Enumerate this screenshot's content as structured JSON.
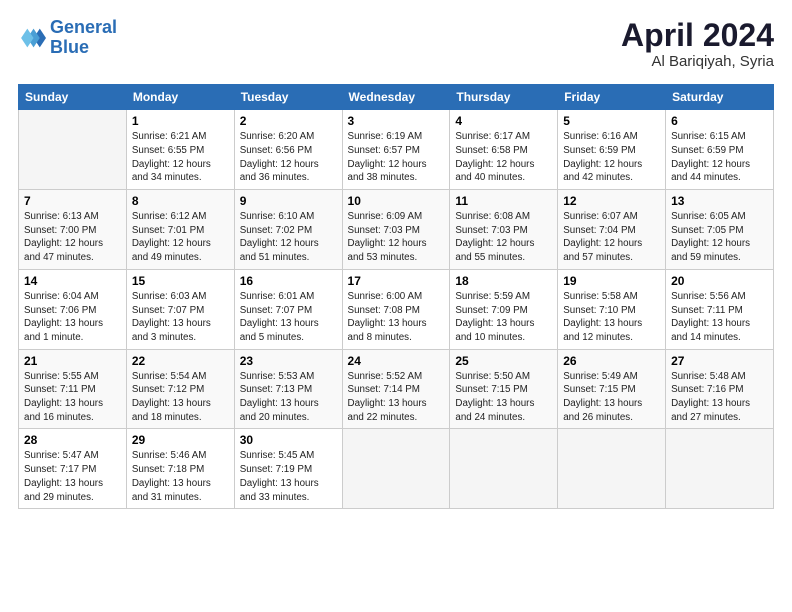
{
  "logo": {
    "line1": "General",
    "line2": "Blue"
  },
  "title": "April 2024",
  "subtitle": "Al Bariqiyah, Syria",
  "days_of_week": [
    "Sunday",
    "Monday",
    "Tuesday",
    "Wednesday",
    "Thursday",
    "Friday",
    "Saturday"
  ],
  "weeks": [
    [
      {
        "day": "",
        "info": ""
      },
      {
        "day": "1",
        "info": "Sunrise: 6:21 AM\nSunset: 6:55 PM\nDaylight: 12 hours\nand 34 minutes."
      },
      {
        "day": "2",
        "info": "Sunrise: 6:20 AM\nSunset: 6:56 PM\nDaylight: 12 hours\nand 36 minutes."
      },
      {
        "day": "3",
        "info": "Sunrise: 6:19 AM\nSunset: 6:57 PM\nDaylight: 12 hours\nand 38 minutes."
      },
      {
        "day": "4",
        "info": "Sunrise: 6:17 AM\nSunset: 6:58 PM\nDaylight: 12 hours\nand 40 minutes."
      },
      {
        "day": "5",
        "info": "Sunrise: 6:16 AM\nSunset: 6:59 PM\nDaylight: 12 hours\nand 42 minutes."
      },
      {
        "day": "6",
        "info": "Sunrise: 6:15 AM\nSunset: 6:59 PM\nDaylight: 12 hours\nand 44 minutes."
      }
    ],
    [
      {
        "day": "7",
        "info": "Sunrise: 6:13 AM\nSunset: 7:00 PM\nDaylight: 12 hours\nand 47 minutes."
      },
      {
        "day": "8",
        "info": "Sunrise: 6:12 AM\nSunset: 7:01 PM\nDaylight: 12 hours\nand 49 minutes."
      },
      {
        "day": "9",
        "info": "Sunrise: 6:10 AM\nSunset: 7:02 PM\nDaylight: 12 hours\nand 51 minutes."
      },
      {
        "day": "10",
        "info": "Sunrise: 6:09 AM\nSunset: 7:03 PM\nDaylight: 12 hours\nand 53 minutes."
      },
      {
        "day": "11",
        "info": "Sunrise: 6:08 AM\nSunset: 7:03 PM\nDaylight: 12 hours\nand 55 minutes."
      },
      {
        "day": "12",
        "info": "Sunrise: 6:07 AM\nSunset: 7:04 PM\nDaylight: 12 hours\nand 57 minutes."
      },
      {
        "day": "13",
        "info": "Sunrise: 6:05 AM\nSunset: 7:05 PM\nDaylight: 12 hours\nand 59 minutes."
      }
    ],
    [
      {
        "day": "14",
        "info": "Sunrise: 6:04 AM\nSunset: 7:06 PM\nDaylight: 13 hours\nand 1 minute."
      },
      {
        "day": "15",
        "info": "Sunrise: 6:03 AM\nSunset: 7:07 PM\nDaylight: 13 hours\nand 3 minutes."
      },
      {
        "day": "16",
        "info": "Sunrise: 6:01 AM\nSunset: 7:07 PM\nDaylight: 13 hours\nand 5 minutes."
      },
      {
        "day": "17",
        "info": "Sunrise: 6:00 AM\nSunset: 7:08 PM\nDaylight: 13 hours\nand 8 minutes."
      },
      {
        "day": "18",
        "info": "Sunrise: 5:59 AM\nSunset: 7:09 PM\nDaylight: 13 hours\nand 10 minutes."
      },
      {
        "day": "19",
        "info": "Sunrise: 5:58 AM\nSunset: 7:10 PM\nDaylight: 13 hours\nand 12 minutes."
      },
      {
        "day": "20",
        "info": "Sunrise: 5:56 AM\nSunset: 7:11 PM\nDaylight: 13 hours\nand 14 minutes."
      }
    ],
    [
      {
        "day": "21",
        "info": "Sunrise: 5:55 AM\nSunset: 7:11 PM\nDaylight: 13 hours\nand 16 minutes."
      },
      {
        "day": "22",
        "info": "Sunrise: 5:54 AM\nSunset: 7:12 PM\nDaylight: 13 hours\nand 18 minutes."
      },
      {
        "day": "23",
        "info": "Sunrise: 5:53 AM\nSunset: 7:13 PM\nDaylight: 13 hours\nand 20 minutes."
      },
      {
        "day": "24",
        "info": "Sunrise: 5:52 AM\nSunset: 7:14 PM\nDaylight: 13 hours\nand 22 minutes."
      },
      {
        "day": "25",
        "info": "Sunrise: 5:50 AM\nSunset: 7:15 PM\nDaylight: 13 hours\nand 24 minutes."
      },
      {
        "day": "26",
        "info": "Sunrise: 5:49 AM\nSunset: 7:15 PM\nDaylight: 13 hours\nand 26 minutes."
      },
      {
        "day": "27",
        "info": "Sunrise: 5:48 AM\nSunset: 7:16 PM\nDaylight: 13 hours\nand 27 minutes."
      }
    ],
    [
      {
        "day": "28",
        "info": "Sunrise: 5:47 AM\nSunset: 7:17 PM\nDaylight: 13 hours\nand 29 minutes."
      },
      {
        "day": "29",
        "info": "Sunrise: 5:46 AM\nSunset: 7:18 PM\nDaylight: 13 hours\nand 31 minutes."
      },
      {
        "day": "30",
        "info": "Sunrise: 5:45 AM\nSunset: 7:19 PM\nDaylight: 13 hours\nand 33 minutes."
      },
      {
        "day": "",
        "info": ""
      },
      {
        "day": "",
        "info": ""
      },
      {
        "day": "",
        "info": ""
      },
      {
        "day": "",
        "info": ""
      }
    ]
  ]
}
